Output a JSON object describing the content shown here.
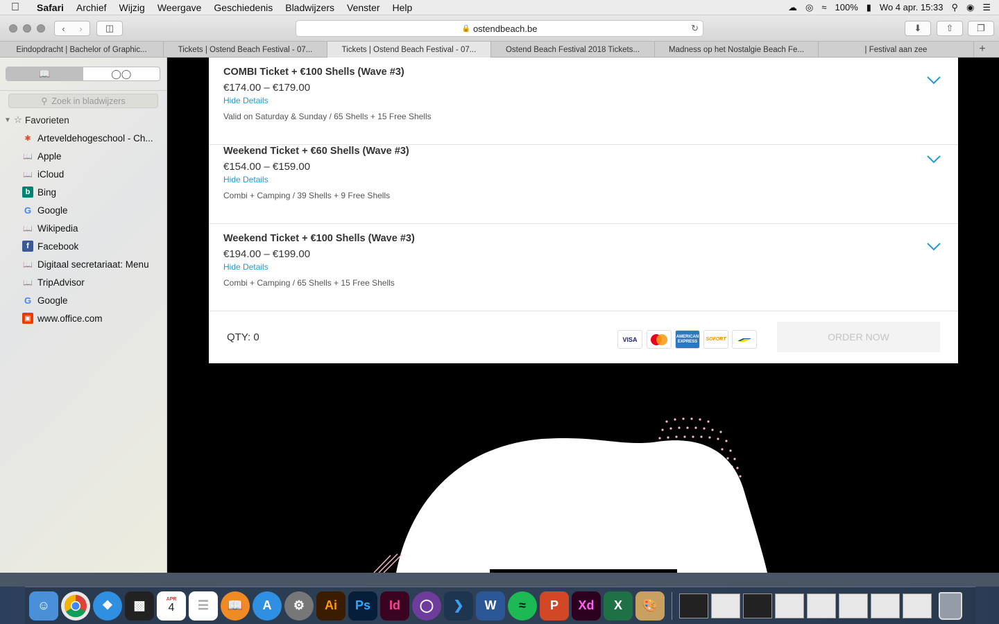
{
  "menubar": {
    "app_name": "Safari",
    "items": [
      "Archief",
      "Wijzig",
      "Weergave",
      "Geschiedenis",
      "Bladwijzers",
      "Venster",
      "Help"
    ],
    "battery": "100%",
    "datetime": "Wo 4 apr.  15:33"
  },
  "toolbar": {
    "url": "ostendbeach.be"
  },
  "tabs": [
    "Eindopdracht | Bachelor of Graphic...",
    "Tickets | Ostend Beach Festival - 07...",
    "Tickets | Ostend Beach Festival - 07...",
    "Ostend Beach Festival 2018 Tickets...",
    "Madness op het Nostalgie Beach Fe...",
    "| Festival aan zee"
  ],
  "active_tab_index": 2,
  "sidebar": {
    "search_placeholder": "Zoek in bladwijzers",
    "section_title": "Favorieten",
    "items": [
      {
        "label": "Arteveldehogeschool - Ch...",
        "icon": "arteveldehogeschool-icon"
      },
      {
        "label": "Apple",
        "icon": "book-icon"
      },
      {
        "label": "iCloud",
        "icon": "book-icon"
      },
      {
        "label": "Bing",
        "icon": "bing-icon"
      },
      {
        "label": "Google",
        "icon": "google-icon"
      },
      {
        "label": "Wikipedia",
        "icon": "book-icon"
      },
      {
        "label": "Facebook",
        "icon": "facebook-icon"
      },
      {
        "label": "Digitaal secretariaat: Menu",
        "icon": "book-icon"
      },
      {
        "label": "TripAdvisor",
        "icon": "book-icon"
      },
      {
        "label": "Google",
        "icon": "google-icon"
      },
      {
        "label": "www.office.com",
        "icon": "office-icon"
      }
    ]
  },
  "tickets": [
    {
      "name": "COMBI Ticket + €100 Shells (Wave #3)",
      "price": "€174.00 – €179.00",
      "toggle": "Hide Details",
      "desc": "Valid on Saturday & Sunday / 65 Shells + 15 Free Shells"
    },
    {
      "name": "Weekend Ticket + €60 Shells (Wave #3)",
      "price": "€154.00 – €159.00",
      "toggle": "Hide Details",
      "desc": "Combi + Camping / 39 Shells + 9 Free Shells"
    },
    {
      "name": "Weekend Ticket + €100 Shells (Wave #3)",
      "price": "€194.00 – €199.00",
      "toggle": "Hide Details",
      "desc": "Combi + Camping / 65 Shells + 15 Free Shells"
    }
  ],
  "order": {
    "qty_label": "QTY: 0",
    "button": "ORDER NOW",
    "payment_labels": {
      "visa": "VISA",
      "mastercard": "MasterCard",
      "amex": "AMERICAN EXPRESS",
      "sofort": "SOFORT"
    }
  },
  "dock": {
    "calendar_month": "APR",
    "calendar_day": "4",
    "apps": [
      {
        "name": "finder-icon",
        "label": "",
        "color": "#4a90d9"
      },
      {
        "name": "chrome-icon",
        "label": "",
        "color": "#e8e8e8"
      },
      {
        "name": "safari-icon",
        "label": "",
        "color": "#2f8fe0"
      },
      {
        "name": "activity-monitor-icon",
        "label": "",
        "color": "#222"
      },
      {
        "name": "calendar-icon",
        "label": "",
        "color": "#fff"
      },
      {
        "name": "reminders-icon",
        "label": "",
        "color": "#fff"
      },
      {
        "name": "ibooks-icon",
        "label": "",
        "color": "#f08a24"
      },
      {
        "name": "app-store-icon",
        "label": "",
        "color": "#2f8fe0"
      },
      {
        "name": "system-preferences-icon",
        "label": "",
        "color": "#777"
      },
      {
        "name": "illustrator-icon",
        "label": "Ai",
        "color": "#3a1c00"
      },
      {
        "name": "photoshop-icon",
        "label": "Ps",
        "color": "#061e3a"
      },
      {
        "name": "indesign-icon",
        "label": "Id",
        "color": "#3a0320"
      },
      {
        "name": "github-icon",
        "label": "",
        "color": "#6e3d9c"
      },
      {
        "name": "vscode-icon",
        "label": "",
        "color": "#1e3550"
      },
      {
        "name": "word-icon",
        "label": "W",
        "color": "#2b5797"
      },
      {
        "name": "spotify-icon",
        "label": "",
        "color": "#1db954"
      },
      {
        "name": "powerpoint-icon",
        "label": "P",
        "color": "#d24726"
      },
      {
        "name": "xd-icon",
        "label": "Xd",
        "color": "#2e001f"
      },
      {
        "name": "excel-icon",
        "label": "X",
        "color": "#1e7145"
      },
      {
        "name": "paintbrush-icon",
        "label": "",
        "color": "#c8a060"
      }
    ]
  },
  "colors": {
    "accent_blue": "#1d9bd6",
    "page_background": "#000000"
  }
}
